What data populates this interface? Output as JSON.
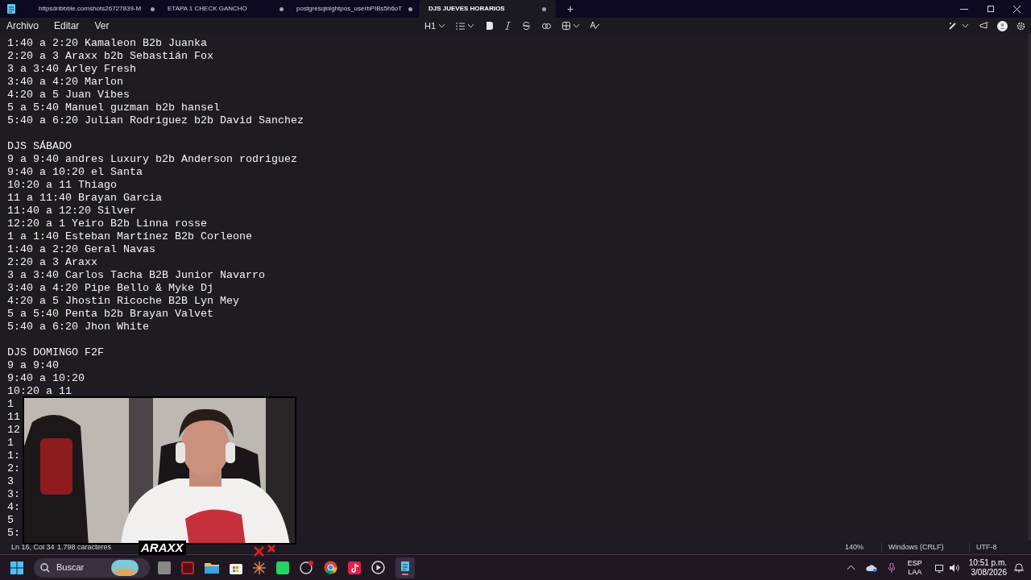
{
  "tabs": [
    {
      "label": "httpsdribbble.comshots26727839-M",
      "selected": false,
      "modified": true
    },
    {
      "label": "ETAPA 1 CHECK GANCHO",
      "selected": false,
      "modified": true
    },
    {
      "label": "postgresqlnightpos_userbPIBs5h6oT",
      "selected": false,
      "modified": true
    },
    {
      "label": "DJS JUEVES HORARIOS",
      "selected": true,
      "modified": true
    }
  ],
  "new_tab": "+",
  "menu": [
    "Archivo",
    "Editar",
    "Ver"
  ],
  "format_toolbar": {
    "heading": "H1"
  },
  "document": {
    "sections": [
      {
        "lines": [
          "1:40 a 2:20 Kamaleon B2b Juanka",
          "2:20 a 3 Araxx b2b Sebastián Fox",
          "3 a 3:40 Arley Fresh",
          "3:40 a 4:20 Marlon",
          "4:20 a 5 Juan Vibes",
          "5 a 5:40 Manuel guzman b2b hansel",
          "5:40 a 6:20 Julian Rodriguez b2b David Sanchez"
        ]
      },
      {
        "heading": "DJS SÁBADO",
        "lines": [
          "9 a 9:40 andres Luxury b2b Anderson rodriguez",
          "9:40 a 10:20 el Santa",
          "10:20 a 11 Thiago",
          "11 a 11:40 Brayan Garcia",
          "11:40 a 12:20 Silver",
          "12:20 a 1 Yeiro B2b Linna rosse",
          "1 a 1:40 Esteban Martínez B2b Corleone",
          "1:40 a 2:20 Geral Navas",
          "2:20 a 3 Araxx",
          "3 a 3:40 Carlos Tacha B2B Junior Navarro",
          "3:40 a 4:20 Pipe Bello & Myke Dj",
          "4:20 a 5 Jhostin Ricoche B2B Lyn Mey",
          "5 a 5:40 Penta b2b Brayan Valvet",
          "5:40 a 6:20 Jhon White"
        ]
      },
      {
        "heading": "DJS DOMINGO F2F",
        "lines": [
          "9 a 9:40",
          "9:40 a 10:20",
          "10:20 a 11",
          "1",
          "11",
          "12",
          "1",
          "1:",
          "2:",
          "3",
          "3:",
          "4:",
          "5",
          "5:"
        ]
      }
    ]
  },
  "overlay": {
    "logo": "ARAXX"
  },
  "status_bar": {
    "position": "Ln 16, Col 34",
    "characters": "1.798 caracteres",
    "zoom": "140%",
    "line_endings": "Windows (CRLF)",
    "encoding": "UTF-8"
  },
  "taskbar": {
    "search_placeholder": "Buscar",
    "language": "ESP",
    "layout": "LAA",
    "time": "10:51 p.m.",
    "date": "3/08/2026"
  }
}
